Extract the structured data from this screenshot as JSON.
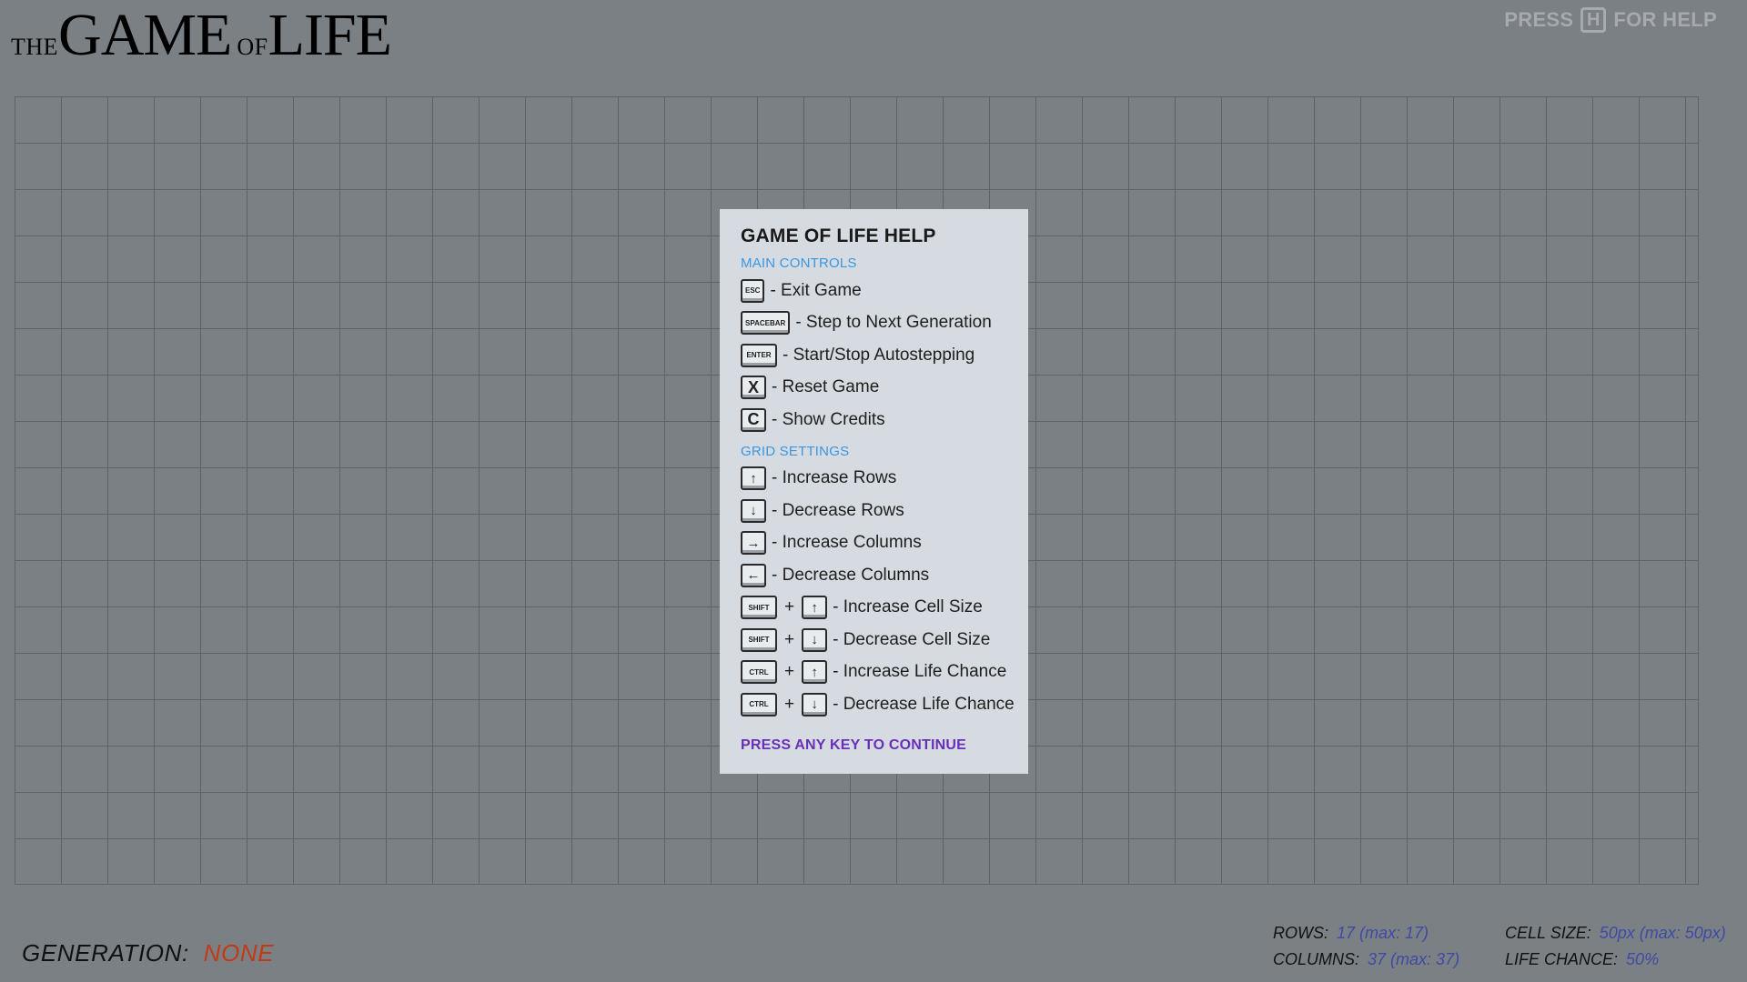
{
  "logo": {
    "the": "THE",
    "game": "GAME",
    "of": "OF",
    "life": "LIFE"
  },
  "help_hint": {
    "press": "PRESS",
    "key": "H",
    "for_help": "FOR HELP"
  },
  "help": {
    "title": "GAME OF LIFE HELP",
    "main_controls_heading": "MAIN CONTROLS",
    "main_controls": [
      {
        "key": "ESC",
        "label": "- Exit Game"
      },
      {
        "key": "SPACEBAR",
        "label": "- Step to Next Generation"
      },
      {
        "key": "ENTER",
        "label": "- Start/Stop Autostepping"
      },
      {
        "key": "X",
        "label": "- Reset Game"
      },
      {
        "key": "C",
        "label": "- Show Credits"
      }
    ],
    "grid_settings_heading": "GRID SETTINGS",
    "grid_settings": [
      {
        "key": "↑",
        "label": "- Increase Rows"
      },
      {
        "key": "↓",
        "label": "- Decrease Rows"
      },
      {
        "key": "→",
        "label": "- Increase Columns"
      },
      {
        "key": "←",
        "label": "- Decrease Columns"
      },
      {
        "mod": "SHIFT",
        "plus": "+",
        "key": "↑",
        "label": "- Increase Cell Size"
      },
      {
        "mod": "SHIFT",
        "plus": "+",
        "key": "↓",
        "label": "- Decrease Cell Size"
      },
      {
        "mod": "CTRL",
        "plus": "+",
        "key": "↑",
        "label": "- Increase Life Chance"
      },
      {
        "mod": "CTRL",
        "plus": "+",
        "key": "↓",
        "label": "- Decrease Life Chance"
      }
    ],
    "continue": "PRESS ANY KEY TO CONTINUE"
  },
  "status": {
    "generation_label": "GENERATION:",
    "generation_value": "NONE",
    "rows_label": "ROWS:",
    "rows_value": "17 (max: 17)",
    "columns_label": "COLUMNS:",
    "columns_value": "37 (max: 37)",
    "cell_size_label": "CELL SIZE:",
    "cell_size_value": "50px (max: 50px)",
    "life_chance_label": "LIFE CHANCE:",
    "life_chance_value": "50%"
  },
  "colors": {
    "background": "#7b8084",
    "panel": "#d5dbe0",
    "section_heading": "#3c96e0",
    "continue": "#6a2fb8",
    "generation_value": "#c23a14",
    "stat_value": "#3e4aa5"
  }
}
